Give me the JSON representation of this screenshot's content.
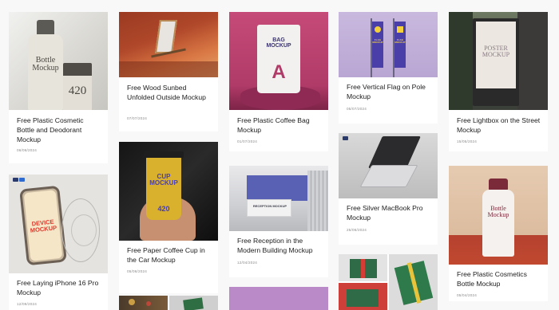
{
  "colors": {
    "page_bg": "#f8f8f8",
    "card_bg": "#ffffff",
    "title": "#1d1d1d",
    "date": "#8a8a8a"
  },
  "cards": [
    {
      "title": "Free Plastic Cosmetic Bottle and Deodorant Mockup",
      "date": "06/06/2024",
      "image_text": {
        "bottle": "Bottle Mockup",
        "number": "420"
      }
    },
    {
      "title": "Free Wood Sunbed Unfolded Outside Mockup",
      "date": "07/07/2024"
    },
    {
      "title": "Free Plastic Coffee Bag Mockup",
      "date": "01/07/2024",
      "image_text": {
        "label": "BAG MOCKUP",
        "letter": "A"
      }
    },
    {
      "title": "Free Vertical Flag on Pole Mockup",
      "date": "05/07/2024",
      "image_text": {
        "flag": "FLAG MOCKUP"
      }
    },
    {
      "title": "Free Lightbox on the Street Mockup",
      "date": "15/05/2024",
      "image_text": {
        "poster": "POSTER MOCKUP"
      }
    },
    {
      "title": "Free Laying iPhone 16 Pro Mockup",
      "date": "12/09/2024",
      "image_text": {
        "device": "DEVICE MOCKUP"
      }
    },
    {
      "title": "Free Paper Coffee Cup in the Car Mockup",
      "date": "05/06/2024",
      "image_text": {
        "cup": "CUP MOCKUP",
        "number": "420"
      }
    },
    {
      "title": "Free Silver MacBook Pro Mockup",
      "date": "25/06/2024"
    },
    {
      "title": "Free Reception in the Modern Building Mockup",
      "date": "12/04/2024",
      "image_text": {
        "sign": "RECEPTION MOCKUP"
      }
    },
    {
      "title": "Free Plastic Cosmetics Bottle Mockup",
      "date": "05/04/2024",
      "image_text": {
        "bottle": "Bottle Mockup"
      }
    }
  ]
}
